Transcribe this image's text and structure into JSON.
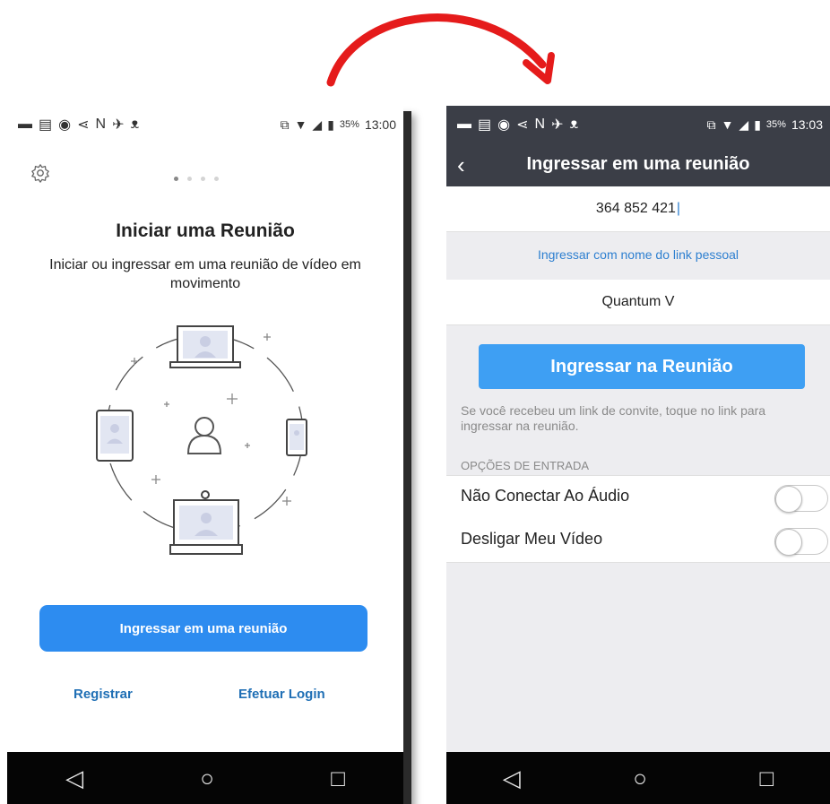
{
  "left": {
    "status": {
      "percent": "35%",
      "time": "13:00"
    },
    "title": "Iniciar uma Reunião",
    "subtitle": "Iniciar ou ingressar em uma reunião de vídeo em movimento",
    "join_button": "Ingressar em uma reunião",
    "register_link": "Registrar",
    "login_link": "Efetuar Login",
    "nav": {
      "back": "◁",
      "home": "○",
      "recent": "□"
    }
  },
  "right": {
    "status": {
      "percent": "35%",
      "time": "13:03"
    },
    "header": {
      "back": "‹",
      "title": "Ingressar em uma reunião"
    },
    "meeting_id": "364 852 421",
    "personal_link": "Ingressar com nome do link pessoal",
    "name": "Quantum V",
    "join_button": "Ingressar na Reunião",
    "note": "Se você recebeu um link de convite, toque no link para ingressar na reunião.",
    "section": "OPÇÕES DE ENTRADA",
    "options": [
      {
        "label": "Não Conectar Ao Áudio",
        "on": false
      },
      {
        "label": "Desligar Meu Vídeo",
        "on": false
      }
    ],
    "nav": {
      "back": "◁",
      "home": "○",
      "recent": "□"
    }
  },
  "colors": {
    "arrow": "#e51b1b",
    "accent": "#2d8cf0",
    "header": "#3b3e47",
    "link": "#2d7fd0"
  },
  "icons": [
    "gear-icon",
    "chevron-left-icon",
    "laptop-icon",
    "tablet-icon",
    "phone-icon",
    "person-icon",
    "webcam-icon"
  ]
}
